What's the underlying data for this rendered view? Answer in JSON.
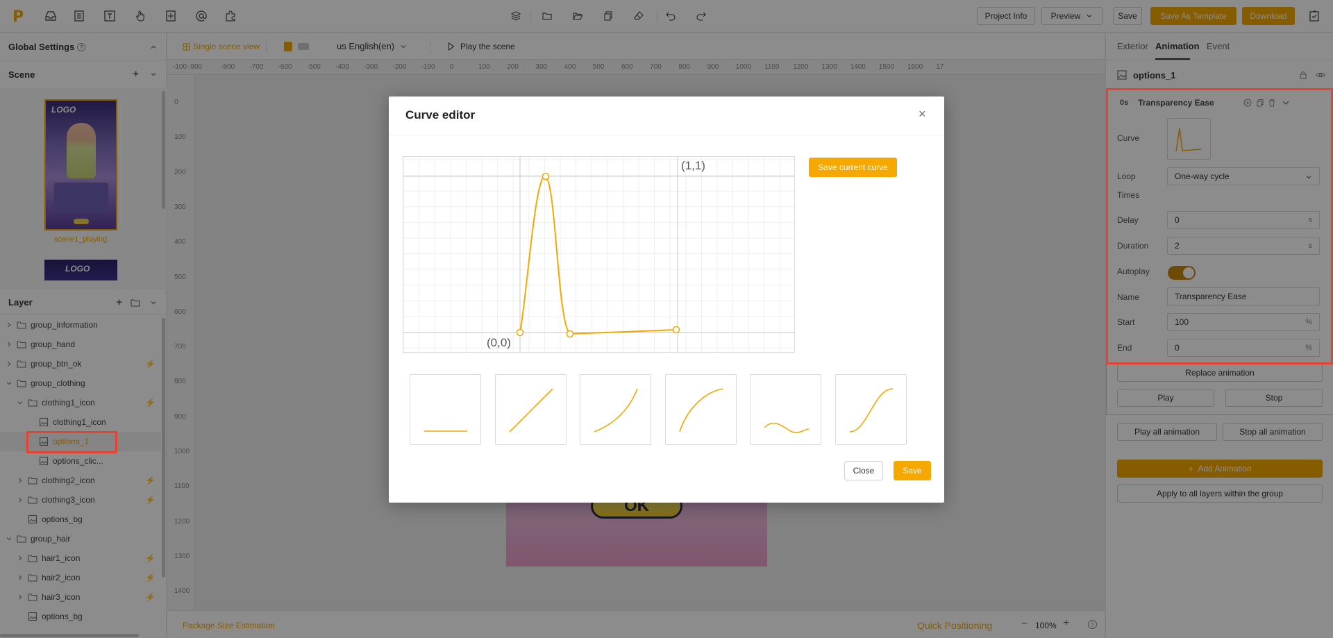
{
  "topbar": {
    "logo": "P",
    "project_info": "Project Info",
    "preview": "Preview",
    "save": "Save",
    "save_as_template": "Save As Template",
    "download": "Download"
  },
  "left": {
    "global_settings": "Global Settings",
    "scene_title": "Scene",
    "scene_name": "scene1_playing",
    "thumb_logo": "LOGO",
    "layer_title": "Layer",
    "layers": [
      {
        "label": "group_information",
        "indent": 0,
        "type": "folder",
        "expanded": false,
        "bolt": false,
        "selected": false
      },
      {
        "label": "group_hand",
        "indent": 0,
        "type": "folder",
        "expanded": false,
        "bolt": false,
        "selected": false
      },
      {
        "label": "group_btn_ok",
        "indent": 0,
        "type": "folder",
        "expanded": false,
        "bolt": true,
        "selected": false
      },
      {
        "label": "group_clothing",
        "indent": 0,
        "type": "folder",
        "expanded": true,
        "bolt": false,
        "selected": false
      },
      {
        "label": "clothing1_icon",
        "indent": 1,
        "type": "folder",
        "expanded": true,
        "bolt": true,
        "selected": false
      },
      {
        "label": "clothing1_icon",
        "indent": 2,
        "type": "image",
        "expanded": false,
        "bolt": false,
        "selected": false
      },
      {
        "label": "options_1",
        "indent": 2,
        "type": "image",
        "expanded": false,
        "bolt": false,
        "selected": true
      },
      {
        "label": "options_clic...",
        "indent": 2,
        "type": "image",
        "expanded": false,
        "bolt": false,
        "selected": false
      },
      {
        "label": "clothing2_icon",
        "indent": 1,
        "type": "folder",
        "expanded": false,
        "bolt": true,
        "selected": false
      },
      {
        "label": "clothing3_icon",
        "indent": 1,
        "type": "folder",
        "expanded": false,
        "bolt": true,
        "selected": false
      },
      {
        "label": "options_bg",
        "indent": 1,
        "type": "image",
        "expanded": false,
        "bolt": false,
        "selected": false
      },
      {
        "label": "group_hair",
        "indent": 0,
        "type": "folder",
        "expanded": true,
        "bolt": false,
        "selected": false
      },
      {
        "label": "hair1_icon",
        "indent": 1,
        "type": "folder",
        "expanded": false,
        "bolt": true,
        "selected": false
      },
      {
        "label": "hair2_icon",
        "indent": 1,
        "type": "folder",
        "expanded": false,
        "bolt": true,
        "selected": false
      },
      {
        "label": "hair3_icon",
        "indent": 1,
        "type": "folder",
        "expanded": false,
        "bolt": true,
        "selected": false
      },
      {
        "label": "options_bg",
        "indent": 1,
        "type": "image",
        "expanded": false,
        "bolt": false,
        "selected": false
      }
    ]
  },
  "canvas": {
    "single_scene_view": "Single scene view",
    "language": "us English(en)",
    "play_scene": "Play the scene",
    "ruler_x": [
      "-100",
      "-900",
      "-800",
      "-700",
      "-600",
      "-500",
      "-400",
      "-300",
      "-200",
      "-100",
      "0",
      "100",
      "200",
      "300",
      "400",
      "500",
      "600",
      "700",
      "800",
      "900",
      "1000",
      "1100",
      "1200",
      "1300",
      "1400",
      "1500",
      "1600",
      "17"
    ],
    "ruler_y": [
      "0",
      "100",
      "200",
      "300",
      "400",
      "500",
      "600",
      "700",
      "800",
      "900",
      "1000",
      "1100",
      "1200",
      "1300",
      "1400"
    ],
    "ok_label": "OK",
    "package_size": "Package Size Estimation",
    "quick_positioning": "Quick Positioning",
    "zoom": "100%"
  },
  "right": {
    "tabs": [
      "Exterior",
      "Animation",
      "Event"
    ],
    "active_tab": "Animation",
    "layer_name": "options_1",
    "anim_time": "0s",
    "anim_title": "Transparency Ease",
    "curve_label": "Curve",
    "loop_label": "Loop",
    "loop_value": "One-way cycle",
    "times_label": "Times",
    "delay_label": "Delay",
    "delay_value": "0",
    "delay_unit": "s",
    "duration_label": "Duration",
    "duration_value": "2",
    "duration_unit": "s",
    "autoplay_label": "Autoplay",
    "autoplay": true,
    "name_label": "Name",
    "name_value": "Transparency Ease",
    "start_label": "Start",
    "start_value": "100",
    "start_unit": "%",
    "end_label": "End",
    "end_value": "0",
    "end_unit": "%",
    "replace": "Replace animation",
    "play": "Play",
    "stop": "Stop",
    "play_all": "Play all animation",
    "stop_all": "Stop all animation",
    "add_animation": "Add Animation",
    "apply_all": "Apply to all layers within the group"
  },
  "modal": {
    "title": "Curve editor",
    "save_current_curve": "Save current curve",
    "origin_label": "(0,0)",
    "end_label": "(1,1)",
    "close": "Close",
    "save": "Save",
    "presets": [
      "constant",
      "linear",
      "ease-in",
      "ease-out",
      "wave",
      "ease-in-out"
    ]
  },
  "colors": {
    "accent": "#f4a800",
    "highlight": "#e8412f"
  }
}
